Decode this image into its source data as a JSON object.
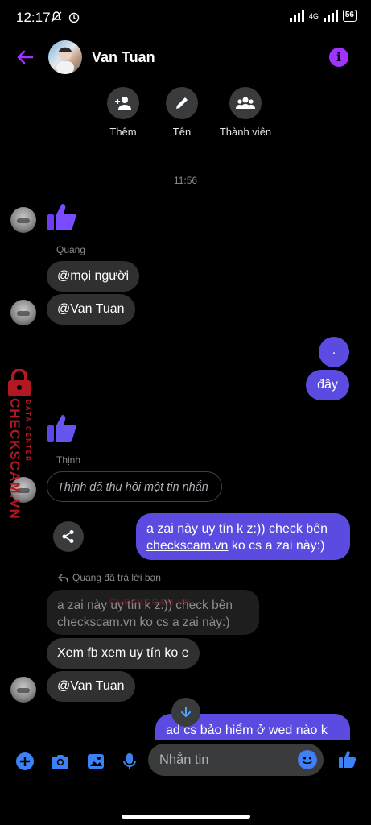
{
  "status_bar": {
    "time": "12:17",
    "network": "4G",
    "battery": "56"
  },
  "header": {
    "contact_name": "Van Tuan"
  },
  "actions": [
    {
      "label": "Thêm",
      "icon": "add-person-icon"
    },
    {
      "label": "Tên",
      "icon": "pencil-icon"
    },
    {
      "label": "Thành viên",
      "icon": "group-icon"
    }
  ],
  "conversation": {
    "timestamp": "11:56",
    "sender_quang": "Quang",
    "msg_moi_nguoi": "@mọi người",
    "msg_van_tuan_1": "@Van Tuan",
    "out_dot": ".",
    "out_day": "đây",
    "sender_thinh": "Thịnh",
    "recalled": "Thịnh đã thu hồi một tin nhắn",
    "out_check_line1": "a zai này uy tín k z:)) check bên",
    "out_check_link": "checkscam.vn",
    "out_check_line2": " ko cs a zai này:)",
    "reply_note": "Quang đã trả lời bạn",
    "quoted_line1": "a zai này uy tín k z:)) check bên",
    "quoted_line2": "checkscam.vn ko cs a zai này:)",
    "msg_xem_fb": "Xem fb xem uy tín ko e",
    "msg_van_tuan_2": "@Van Tuan",
    "out_partial": "ad cs bảo hiểm ở wed nào k"
  },
  "watermark": {
    "brand": "CHECKSCAM.VN",
    "sub": "DATA CENTER"
  },
  "composer": {
    "placeholder": "Nhắn tin"
  },
  "colors": {
    "accent": "#a033ff",
    "outgoing_bubble": "#5b4be0",
    "like": "#6a3cf2"
  }
}
